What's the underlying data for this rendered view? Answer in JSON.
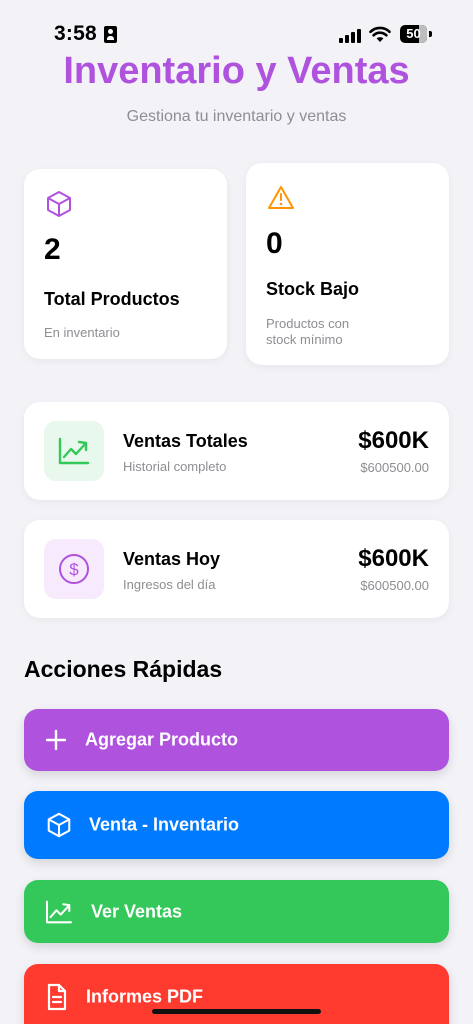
{
  "status_bar": {
    "time": "3:58",
    "battery": "50"
  },
  "header": {
    "title": "Inventario y Ventas",
    "subtitle": "Gestiona tu inventario y ventas"
  },
  "stats": [
    {
      "value": "2",
      "label": "Total Productos",
      "description": "En inventario",
      "icon": "cube-icon"
    },
    {
      "value": "0",
      "label": "Stock Bajo",
      "description": "Productos con stock mínimo",
      "icon": "warning-icon"
    }
  ],
  "sales": [
    {
      "title": "Ventas Totales",
      "subtitle": "Historial completo",
      "amount": "$600K",
      "exact": "$600500.00",
      "icon": "trend-chart-icon"
    },
    {
      "title": "Ventas Hoy",
      "subtitle": "Ingresos del día",
      "amount": "$600K",
      "exact": "$600500.00",
      "icon": "dollar-circle-icon"
    }
  ],
  "quick_actions": {
    "title": "Acciones Rápidas",
    "buttons": [
      {
        "label": "Agregar Producto",
        "icon": "plus-icon",
        "color": "#af52de"
      },
      {
        "label": "Venta - Inventario",
        "icon": "cube-icon",
        "color": "#007aff"
      },
      {
        "label": "Ver Ventas",
        "icon": "trend-chart-icon",
        "color": "#34c759"
      },
      {
        "label": "Informes PDF",
        "icon": "document-icon",
        "color": "#ff3b30"
      }
    ]
  },
  "colors": {
    "accent": "#af52de",
    "warning": "#ff9500",
    "success": "#34c759",
    "blue": "#007aff",
    "red": "#ff3b30"
  }
}
